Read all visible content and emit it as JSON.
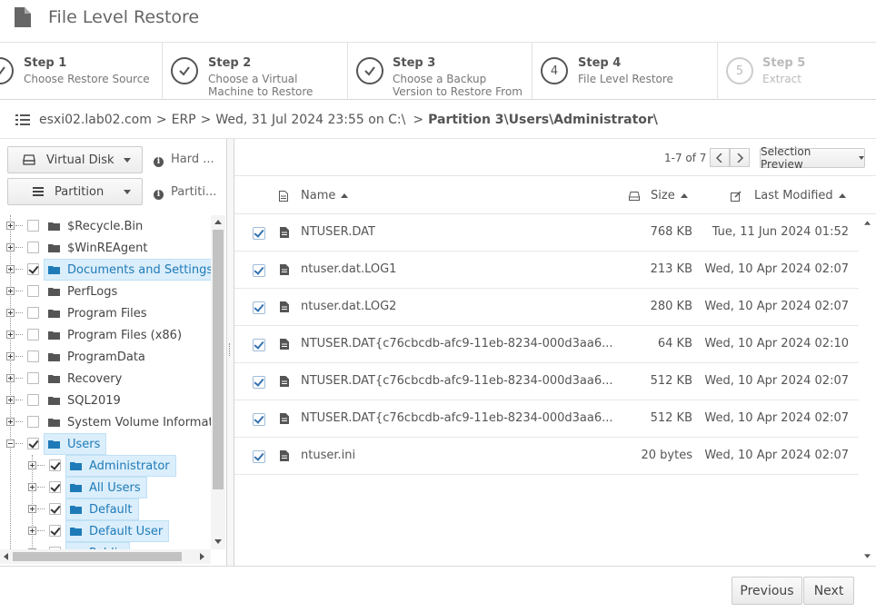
{
  "header": {
    "title": "File Level Restore",
    "icon": "document-icon"
  },
  "steps": [
    {
      "title": "Step 1",
      "sub1": "Choose Restore Source",
      "sub2": "",
      "state": "done"
    },
    {
      "title": "Step 2",
      "sub1": "Choose a Virtual",
      "sub2": "Machine to Restore",
      "state": "done"
    },
    {
      "title": "Step 3",
      "sub1": "Choose a Backup",
      "sub2": "Version to Restore From",
      "state": "done"
    },
    {
      "title": "Step 4",
      "sub1": "File Level Restore",
      "sub2": "",
      "state": "active",
      "number": "4"
    },
    {
      "title": "Step 5",
      "sub1": "Extract",
      "sub2": "",
      "state": "disabled",
      "number": "5"
    }
  ],
  "breadcrumb": {
    "host": "esxi02.lab02.com",
    "vm": "ERP",
    "version": "Wed, 31 Jul 2024 23:55 on C:\\",
    "path": "Partition 3\\Users\\Administrator\\",
    "separator": ">"
  },
  "left": {
    "disk_button": "Virtual Disk",
    "disk_info": "Hard ...",
    "partition_button": "Partition",
    "partition_info": "Partiti...",
    "tree": [
      {
        "label": "$Recycle.Bin",
        "checked": false,
        "selected": false,
        "level": 0
      },
      {
        "label": "$WinREAgent",
        "checked": false,
        "selected": false,
        "level": 0
      },
      {
        "label": "Documents and Settings",
        "checked": true,
        "selected": true,
        "level": 0
      },
      {
        "label": "PerfLogs",
        "checked": false,
        "selected": false,
        "level": 0
      },
      {
        "label": "Program Files",
        "checked": false,
        "selected": false,
        "level": 0
      },
      {
        "label": "Program Files (x86)",
        "checked": false,
        "selected": false,
        "level": 0
      },
      {
        "label": "ProgramData",
        "checked": false,
        "selected": false,
        "level": 0
      },
      {
        "label": "Recovery",
        "checked": false,
        "selected": false,
        "level": 0
      },
      {
        "label": "SQL2019",
        "checked": false,
        "selected": false,
        "level": 0
      },
      {
        "label": "System Volume Informatio",
        "checked": false,
        "selected": false,
        "level": 0
      },
      {
        "label": "Users",
        "checked": true,
        "selected": true,
        "level": 0
      },
      {
        "label": "Administrator",
        "checked": true,
        "selected": true,
        "level": 1
      },
      {
        "label": "All Users",
        "checked": true,
        "selected": true,
        "level": 1
      },
      {
        "label": "Default",
        "checked": true,
        "selected": true,
        "level": 1
      },
      {
        "label": "Default User",
        "checked": true,
        "selected": true,
        "level": 1
      },
      {
        "label": "Public",
        "checked": true,
        "selected": true,
        "level": 1
      }
    ]
  },
  "right": {
    "pager": "1-7 of 7",
    "selection_preview": "Selection Preview",
    "columns": {
      "name": "Name",
      "size": "Size",
      "modified": "Last Modified"
    },
    "files": [
      {
        "name": "NTUSER.DAT",
        "size": "768 KB",
        "modified": "Tue, 11 Jun 2024 01:52",
        "checked": true
      },
      {
        "name": "ntuser.dat.LOG1",
        "size": "213 KB",
        "modified": "Wed, 10 Apr 2024 02:07",
        "checked": true
      },
      {
        "name": "ntuser.dat.LOG2",
        "size": "280 KB",
        "modified": "Wed, 10 Apr 2024 02:07",
        "checked": true
      },
      {
        "name": "NTUSER.DAT{c76cbcdb-afc9-11eb-8234-000d3aa6...",
        "size": "64 KB",
        "modified": "Wed, 10 Apr 2024 02:10",
        "checked": true
      },
      {
        "name": "NTUSER.DAT{c76cbcdb-afc9-11eb-8234-000d3aa6...",
        "size": "512 KB",
        "modified": "Wed, 10 Apr 2024 02:07",
        "checked": true
      },
      {
        "name": "NTUSER.DAT{c76cbcdb-afc9-11eb-8234-000d3aa6...",
        "size": "512 KB",
        "modified": "Wed, 10 Apr 2024 02:07",
        "checked": true
      },
      {
        "name": "ntuser.ini",
        "size": "20 bytes",
        "modified": "Wed, 10 Apr 2024 02:07",
        "checked": true
      }
    ]
  },
  "footer": {
    "previous": "Previous",
    "next": "Next"
  },
  "colors": {
    "accent": "#1f7bb8",
    "selection_bg": "#dbeefb",
    "text": "#555555"
  }
}
